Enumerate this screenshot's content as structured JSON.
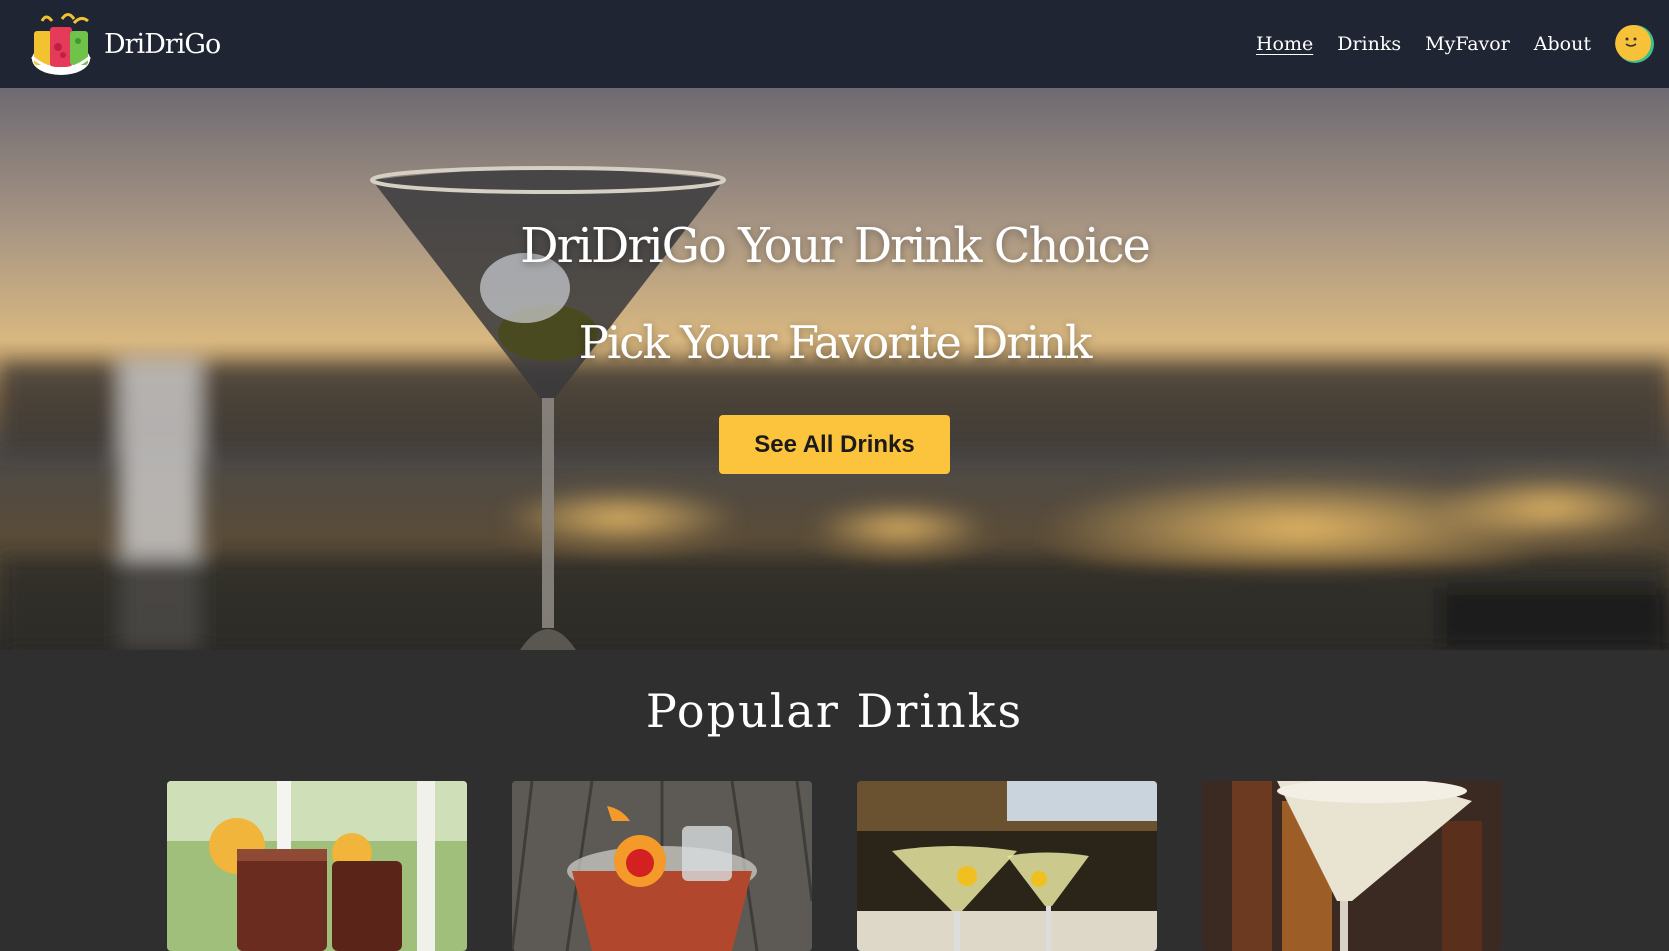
{
  "header": {
    "brand_name": "DriDriGo",
    "logo_icon": "drink-cups-logo-icon",
    "nav": [
      {
        "label": "Home",
        "active": true
      },
      {
        "label": "Drinks",
        "active": false
      },
      {
        "label": "MyFavor",
        "active": false
      },
      {
        "label": "About",
        "active": false
      }
    ],
    "avatar_icon": "smiley-avatar-icon"
  },
  "hero": {
    "title": "DriDriGo Your Drink Choice",
    "subtitle": "Pick Your Favorite Drink",
    "cta_label": "See All Drinks",
    "background": "martini-glass-at-sunset-photo"
  },
  "popular": {
    "title": "Popular Drinks",
    "cards": [
      {
        "image": "iced-tea-glasses-with-lemon-photo"
      },
      {
        "image": "negroni-with-orange-cherry-photo"
      },
      {
        "image": "two-martinis-with-lemon-twist-photo"
      },
      {
        "image": "white-cocktail-martini-glass-photo"
      }
    ]
  },
  "colors": {
    "navbar": "#1f2532",
    "page_bg": "#2f2f2f",
    "accent": "#fcc33d",
    "text": "#ffffff"
  }
}
